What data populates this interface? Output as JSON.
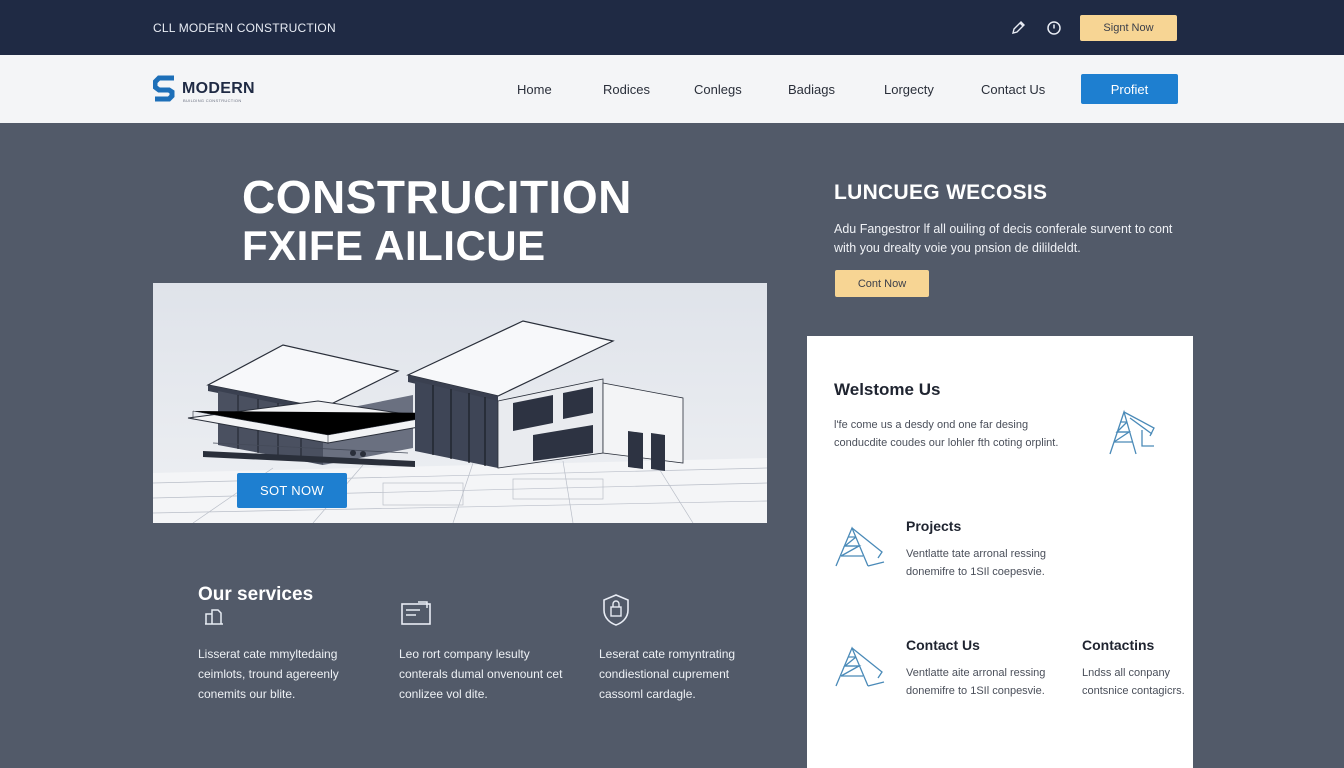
{
  "topbar": {
    "brand": "CLL MODERN CONSTRUCTION",
    "icons": [
      "pencil-icon",
      "clock-icon"
    ],
    "signup_label": "Signt Now"
  },
  "navbar": {
    "logo_name": "MODERN",
    "logo_tagline": "BUILDING CONSTRUCTION",
    "items": [
      "Home",
      "Rodices",
      "Conlegs",
      "Badiags",
      "Lorgecty",
      "Contact Us"
    ],
    "profile_label": "Profiet"
  },
  "hero": {
    "title_line1": "CONSTRUCITION",
    "title_line2": "FXIFE AILICUE",
    "image_button": "SOT NOW"
  },
  "side": {
    "heading": "LUNCUEG WECOSIS",
    "description": "Adu Fangestror lf all ouiling of decis conferale survent to cont with you drealty voie you pnsion de dilildeldt.",
    "button": "Cont Now"
  },
  "services": {
    "title": "Our services",
    "items": [
      {
        "icon": "document-chart-icon",
        "text": "Lisserat cate mmyltedaing ceimlots, tround agereenly conemits our blite."
      },
      {
        "icon": "folder-icon",
        "text": "Leo rort company lesulty conterals dumal onvenount cet conlizee vol dite."
      },
      {
        "icon": "shield-lock-icon",
        "text": "Leserat cate romyntrating condiestional cuprement cassoml cardagle."
      }
    ]
  },
  "panel": {
    "welcome_title": "Welstome Us",
    "welcome_text": "l'fe come us a desdy ond one far desing conducdite coudes our lohler fth coting orplint.",
    "projects_title": "Projects",
    "projects_text": "Ventlatte tate arronal ressing donemifre to 1SIl coepesvie.",
    "contact_title": "Contact Us",
    "contact_text": "Ventlatte aite arronal ressing donemifre to 1SIl conpesvie.",
    "contactins_title": "Contactins",
    "contactins_text": "Lndss all conpany contsnice contagicrs."
  }
}
